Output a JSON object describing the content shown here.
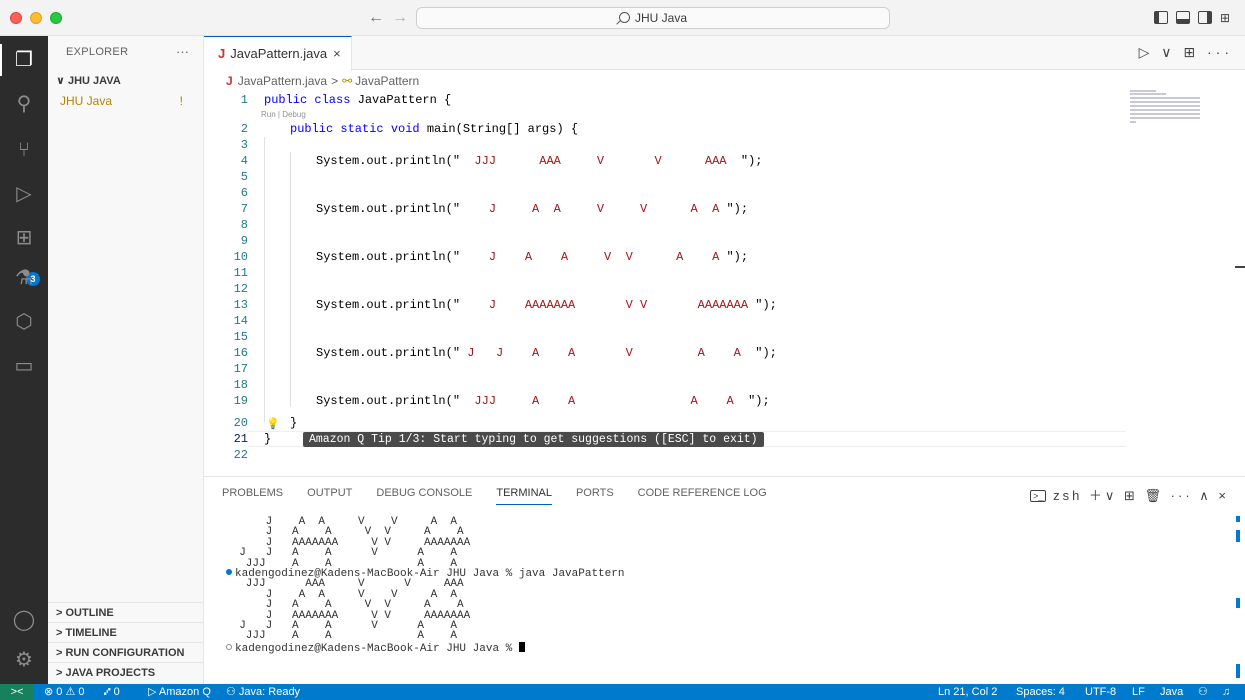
{
  "window": {
    "search_text": "JHU Java"
  },
  "activity_bar": {
    "extensions_badge": "3"
  },
  "sidebar": {
    "title": "EXPLORER",
    "more": "···",
    "folder": "JHU JAVA",
    "file": "JHU Java",
    "file_status": "!",
    "sections": [
      "OUTLINE",
      "TIMELINE",
      "RUN CONFIGURATION",
      "JAVA PROJECTS"
    ]
  },
  "editor": {
    "tab_label": "JavaPattern.java",
    "tab_close": "×",
    "breadcrumb_file": "JavaPattern.java",
    "breadcrumb_sep": ">",
    "breadcrumb_class": "JavaPattern",
    "codelens": "Run | Debug",
    "tip": "Amazon Q Tip 1/3: Start typing to get suggestions ([ESC] to exit)",
    "actions": "▷ ∨ ⊞ ···",
    "line_numbers": [
      "1",
      "2",
      "3",
      "4",
      "5",
      "6",
      "7",
      "8",
      "9",
      "10",
      "11",
      "12",
      "13",
      "14",
      "15",
      "16",
      "17",
      "18",
      "19",
      "20",
      "21",
      "22"
    ],
    "code": {
      "l1_kw": "public class ",
      "l1_rest": "JavaPattern {",
      "l2_kw": "public static void ",
      "l2_rest": "main(String[] args) {",
      "call": "System.out.println(\"",
      "end": "\");",
      "s4": "  JJJ      AAA     V       V      AAA  ",
      "s7": "    J     A  A     V     V      A  A ",
      "s10": "    J    A    A     V  V      A    A ",
      "s13": "    J    AAAAAAA       V V       AAAAAAA ",
      "s16": " J   J    A    A       V         A    A  ",
      "s19": "  JJJ     A    A                A    A  ",
      "l20": "}",
      "l21": "}"
    }
  },
  "panel": {
    "tabs": [
      "PROBLEMS",
      "OUTPUT",
      "DEBUG CONSOLE",
      "TERMINAL",
      "PORTS",
      "CODE REFERENCE LOG"
    ],
    "active_tab": "TERMINAL",
    "shell": "zsh",
    "actions": "＋∨ ⊞ 🗑 ··· ∧ ×",
    "terminal_lines": [
      "      J    A  A     V    V     A  A",
      "      J   A    A     V  V     A    A",
      "      J   AAAAAAA     V V     AAAAAAA",
      "  J   J   A    A      V      A    A",
      "   JJJ    A    A             A    A",
      "kadengodinez@Kadens-MacBook-Air JHU Java % java JavaPattern",
      "   JJJ      AAA     V      V     AAA",
      "      J    A  A     V    V     A  A",
      "      J   A    A     V  V     A    A",
      "      J   AAAAAAA     V V     AAAAAAA",
      "  J   J   A    A      V      A    A",
      "   JJJ    A    A             A    A",
      "kadengodinez@Kadens-MacBook-Air JHU Java % "
    ]
  },
  "statusbar": {
    "remote": "><",
    "problems": "⊗ 0 ⚠ 0",
    "ports": "⑇ 0",
    "amazon_q": "▷ Amazon Q",
    "java": "⚇ Java: Ready",
    "position": "Ln 21, Col 2",
    "spaces": "Spaces: 4",
    "encoding": "UTF-8",
    "eol": "LF",
    "language": "Java"
  }
}
